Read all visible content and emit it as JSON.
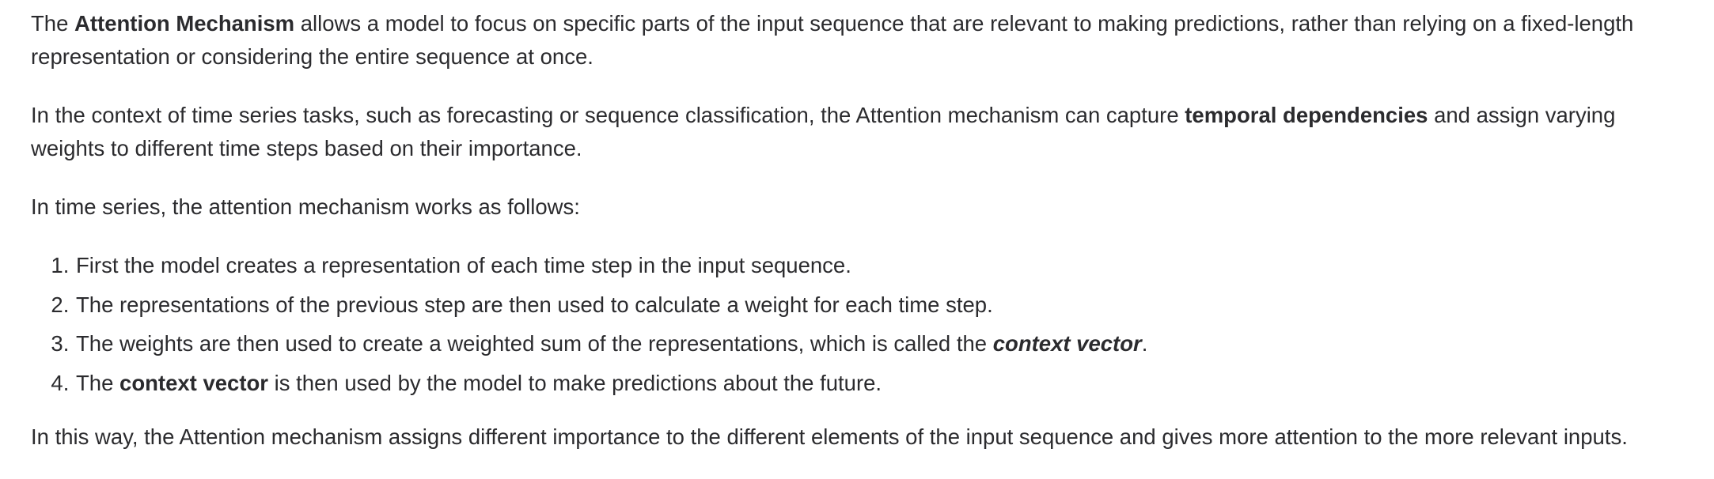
{
  "paragraphs": {
    "p1": {
      "t1": "The ",
      "b1": "Attention Mechanism",
      "t2": " allows a model to focus on specific parts of the input sequence that are relevant to making predictions, rather than relying on a fixed-length representation or considering the entire sequence at once."
    },
    "p2": {
      "t1": "In the context of time series tasks, such as forecasting or sequence classification, the Attention mechanism can capture ",
      "b1": "temporal dependencies",
      "t2": " and assign varying weights to different time steps based on their importance."
    },
    "p3": "In time series, the attention mechanism works as follows:",
    "p4": "In this way, the Attention mechanism assigns different importance to the different elements of the input sequence and gives more attention to the more relevant inputs."
  },
  "steps": [
    {
      "text": "First the model creates a representation of each time step in the input sequence."
    },
    {
      "text": "The representations of the previous step are then used to calculate a weight for each time step."
    },
    {
      "t1": "The weights are then used to create a weighted sum of the representations, which is called the ",
      "em": "context vector",
      "t2": "."
    },
    {
      "t1": "The ",
      "b": "context vector",
      "t2": " is then used by the model to make predictions about the future."
    }
  ]
}
